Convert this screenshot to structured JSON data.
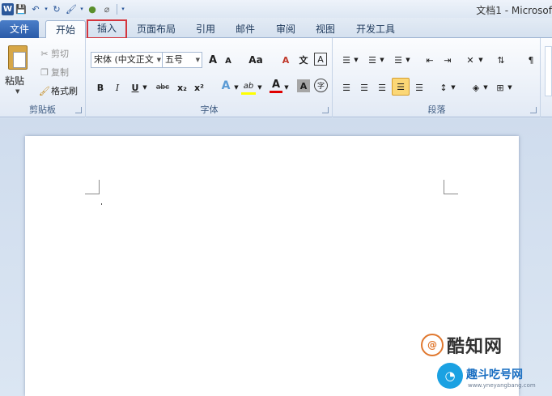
{
  "window": {
    "title": "文档1 - Microsof"
  },
  "quick_access": [
    "W",
    "💾",
    "↶",
    "▾",
    "↻",
    "🖌",
    "▾",
    "●",
    "⌀",
    "▾"
  ],
  "tabs": {
    "file": "文件",
    "home": "开始",
    "insert": "插入",
    "layout": "页面布局",
    "references": "引用",
    "mailings": "邮件",
    "review": "审阅",
    "view": "视图",
    "developer": "开发工具"
  },
  "clipboard": {
    "paste": "粘贴",
    "cut": "剪切",
    "copy": "复制",
    "format_painter": "格式刷",
    "label": "剪贴板"
  },
  "font": {
    "font_name": "宋体 (中文正文",
    "font_size": "五号",
    "grow": "A",
    "shrink": "A",
    "case": "Aa",
    "clear": "A",
    "phonetic": "文",
    "char_border": "A",
    "bold": "B",
    "italic": "I",
    "underline": "U",
    "strike": "abc",
    "subscript": "x₂",
    "superscript": "x²",
    "text_effect": "A",
    "highlight": "ab",
    "font_color": "A",
    "char_shading": "A",
    "enclose": "字",
    "label": "字体"
  },
  "paragraph": {
    "label": "段落"
  },
  "watermark": {
    "brand1": "酷知网",
    "brand1_mark": "@",
    "brand2": "趣斗吃号网",
    "brand2_url": "www.yneyangbang.com",
    "brand2_mark": "◔"
  },
  "colors": {
    "accent": "#2b579a",
    "highlight_box": "#d4353d",
    "highlight_yellow": "#ffff00",
    "font_red": "#e00000"
  }
}
